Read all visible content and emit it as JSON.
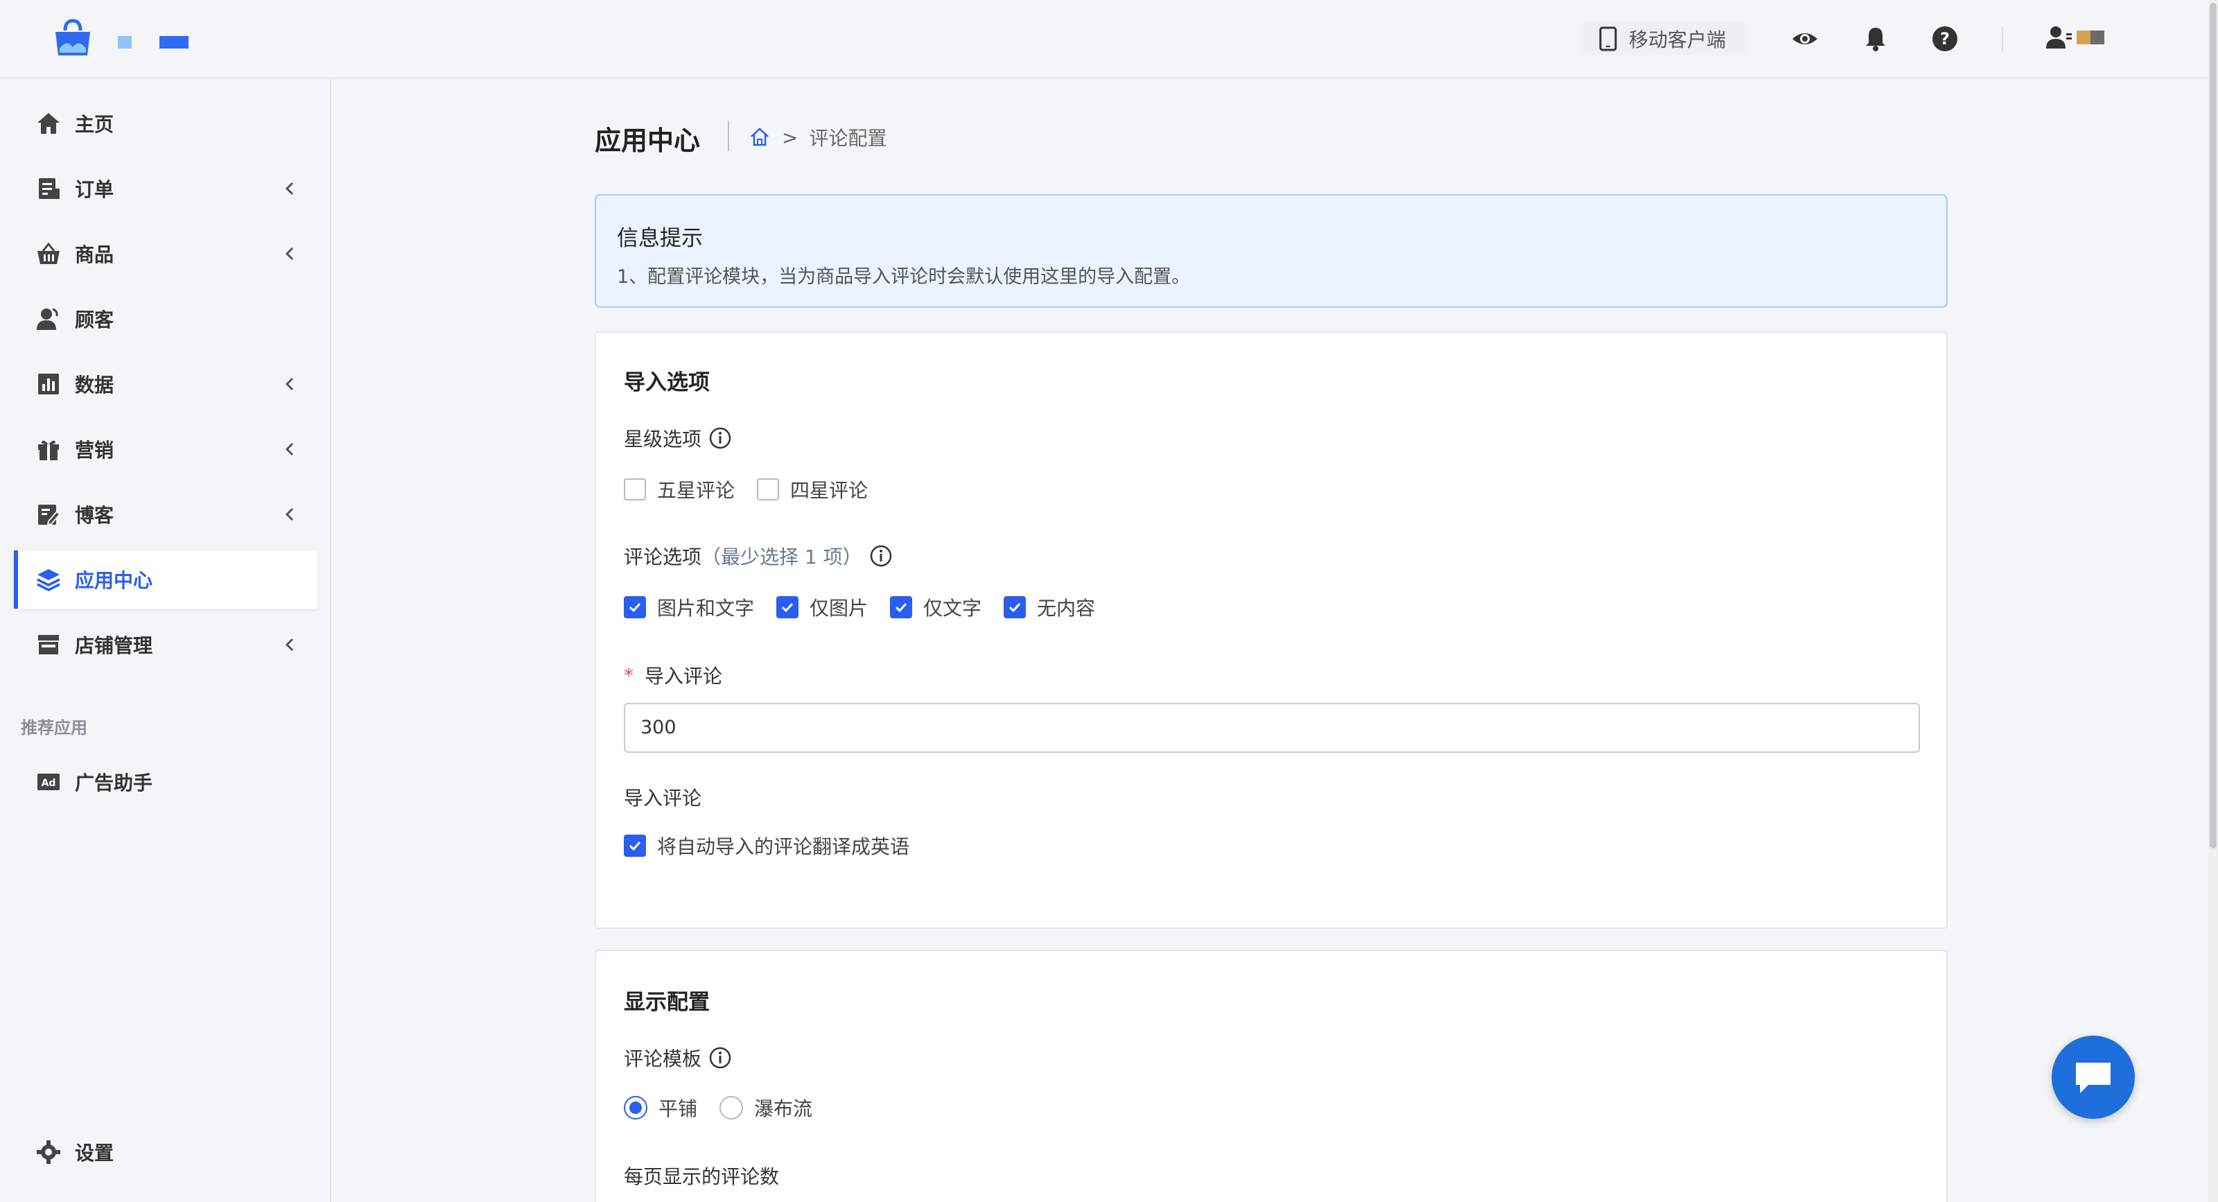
{
  "header": {
    "mobile_client_label": "移动客户端"
  },
  "sidebar": {
    "items": [
      {
        "label": "主页",
        "icon": "home-icon",
        "has_chevron": false
      },
      {
        "label": "订单",
        "icon": "orders-icon",
        "has_chevron": true
      },
      {
        "label": "商品",
        "icon": "basket-icon",
        "has_chevron": true
      },
      {
        "label": "顾客",
        "icon": "user-icon",
        "has_chevron": false
      },
      {
        "label": "数据",
        "icon": "chart-icon",
        "has_chevron": true
      },
      {
        "label": "营销",
        "icon": "gift-icon",
        "has_chevron": true
      },
      {
        "label": "博客",
        "icon": "edit-icon",
        "has_chevron": true
      },
      {
        "label": "应用中心",
        "icon": "layers-icon",
        "has_chevron": false,
        "active": true
      },
      {
        "label": "店铺管理",
        "icon": "store-icon",
        "has_chevron": true
      }
    ],
    "section_recommended": "推荐应用",
    "ad_helper": "广告助手",
    "settings": "设置"
  },
  "page": {
    "title": "应用中心",
    "breadcrumb_current": "评论配置"
  },
  "info_box": {
    "title": "信息提示",
    "text": "1、配置评论模块，当为商品导入评论时会默认使用这里的导入配置。"
  },
  "import_card": {
    "title": "导入选项",
    "star_label": "星级选项",
    "star_options": [
      {
        "label": "五星评论",
        "checked": false
      },
      {
        "label": "四星评论",
        "checked": false
      }
    ],
    "review_label": "评论选项",
    "review_hint": "（最少选择 1 项）",
    "review_options": [
      {
        "label": "图片和文字",
        "checked": true
      },
      {
        "label": "仅图片",
        "checked": true
      },
      {
        "label": "仅文字",
        "checked": true
      },
      {
        "label": "无内容",
        "checked": true
      }
    ],
    "import_count_label": "导入评论",
    "import_count_value": "300",
    "translate_label": "导入评论",
    "translate_option": "将自动导入的评论翻译成英语",
    "translate_checked": true
  },
  "display_card": {
    "title": "显示配置",
    "template_label": "评论模板",
    "template_options": [
      {
        "label": "平铺",
        "selected": true
      },
      {
        "label": "瀑布流",
        "selected": false
      }
    ],
    "per_page_label": "每页显示的评论数"
  },
  "colors": {
    "accent": "#2a5ef0",
    "info_bg": "#eaf3ff",
    "chat_button": "#1e6fdc"
  }
}
